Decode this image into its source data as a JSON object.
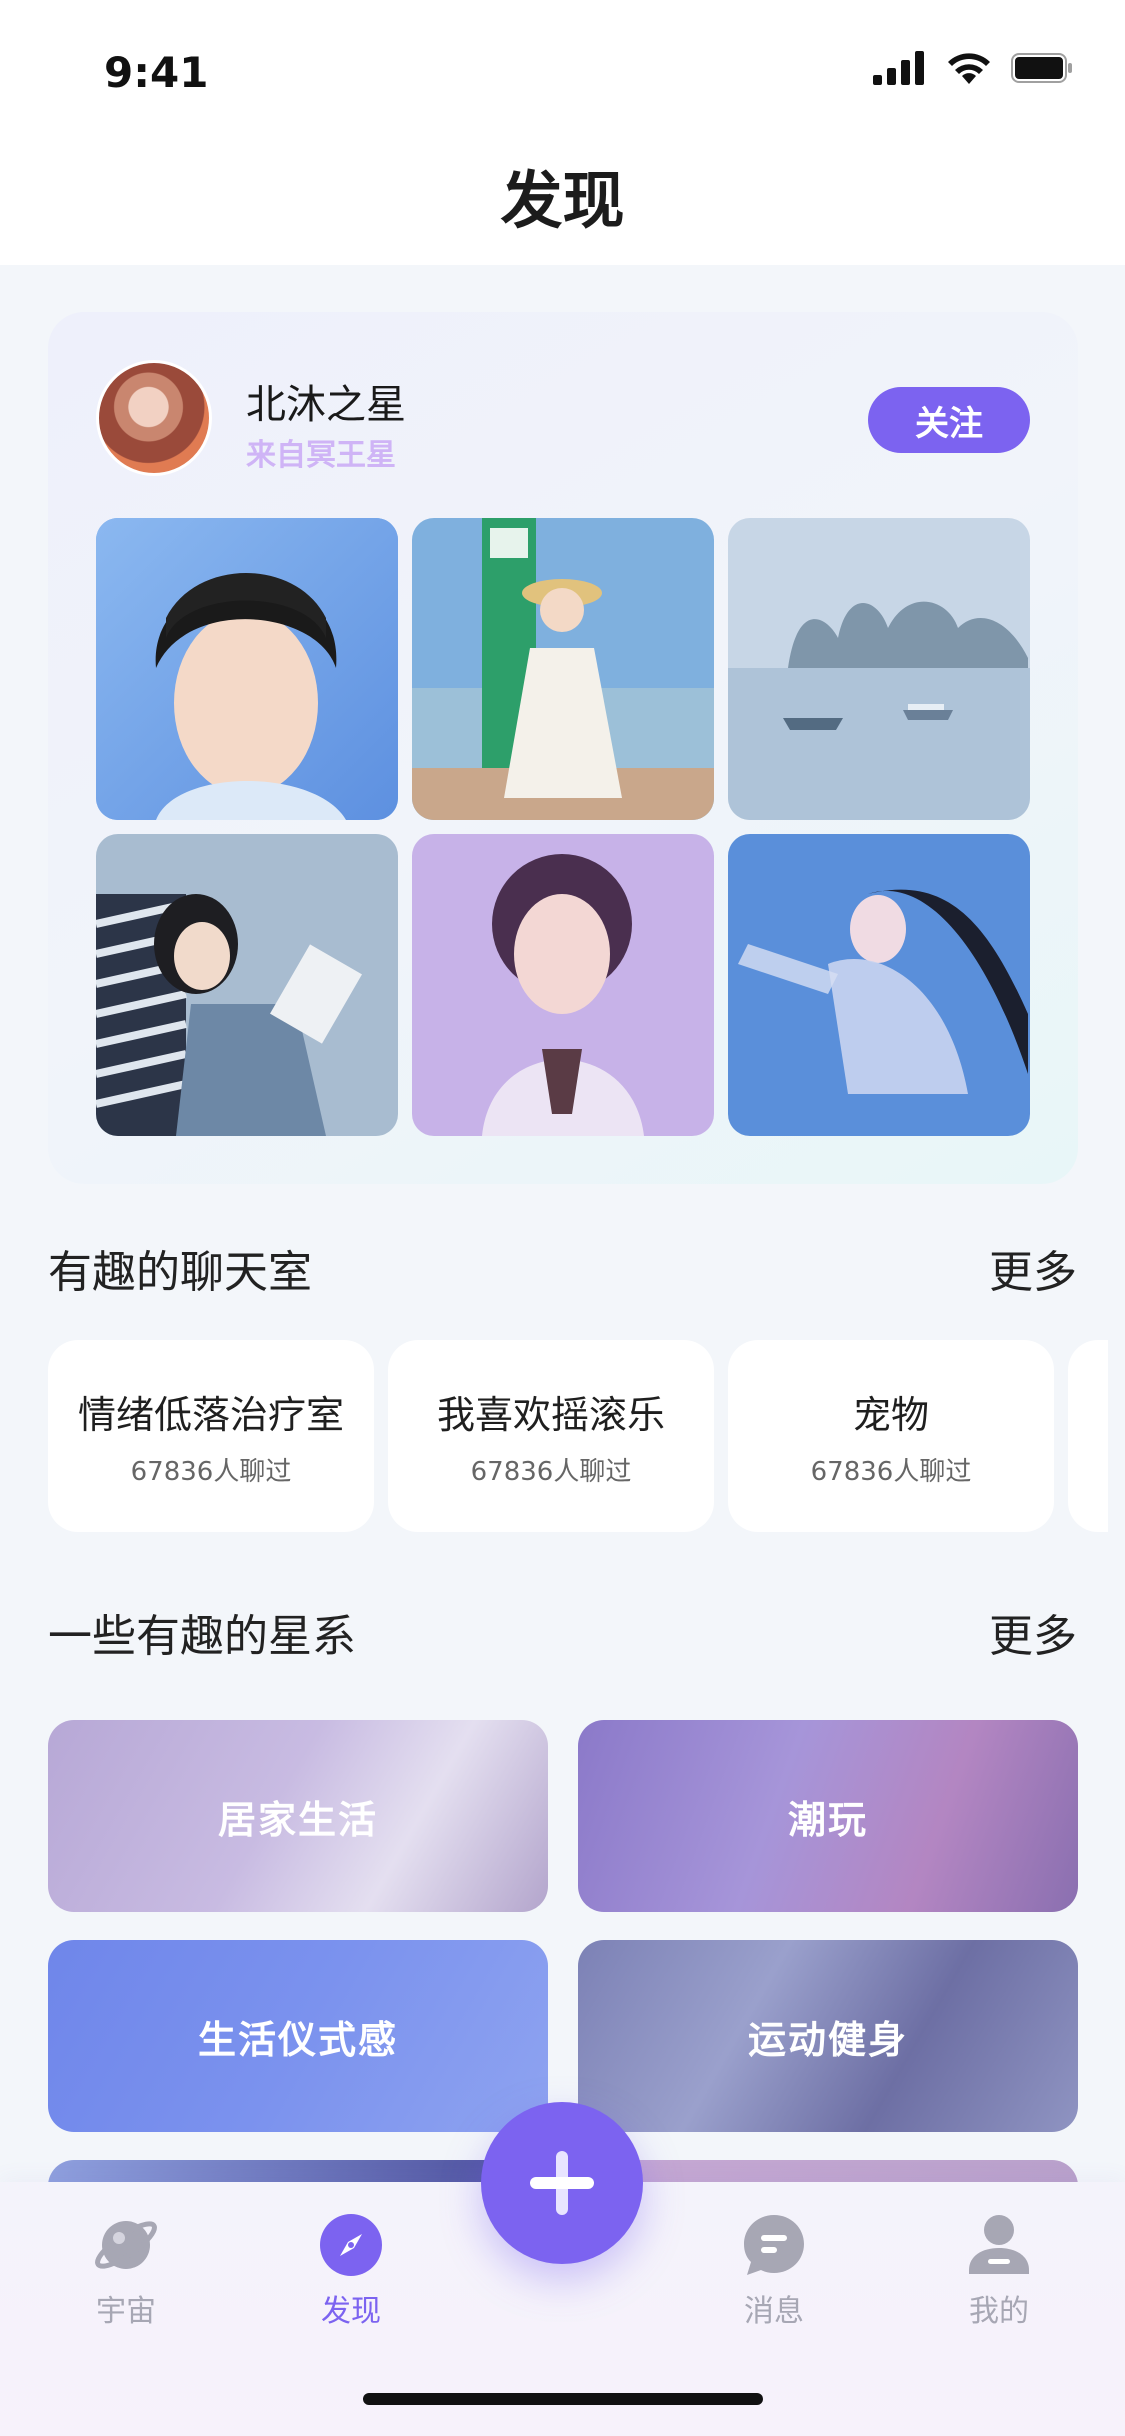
{
  "status_bar": {
    "time": "9:41"
  },
  "header": {
    "title": "发现"
  },
  "featured": {
    "author_name": "北沐之星",
    "author_from": "来自冥王星",
    "follow_label": "关注",
    "photos": [
      "portrait-boy-blue",
      "girl-straw-hat-lake",
      "misty-lake-boats",
      "girl-lying-reading",
      "girl-purple-haze",
      "girl-underwater-blue"
    ]
  },
  "chat_section": {
    "title": "有趣的聊天室",
    "more": "更多",
    "rooms": [
      {
        "name": "情绪低落治疗室",
        "count": "67836人聊过"
      },
      {
        "name": "我喜欢摇滚乐",
        "count": "67836人聊过"
      },
      {
        "name": "宠物",
        "count": "67836人聊过"
      }
    ]
  },
  "galaxy_section": {
    "title": "一些有趣的星系",
    "more": "更多",
    "items": [
      "居家生活",
      "潮玩",
      "生活仪式感",
      "运动健身"
    ]
  },
  "tabbar": {
    "items": [
      {
        "label": "宇宙",
        "icon": "planet-icon"
      },
      {
        "label": "发现",
        "icon": "compass-icon"
      },
      {
        "label": "消息",
        "icon": "message-icon"
      },
      {
        "label": "我的",
        "icon": "profile-icon"
      }
    ],
    "fab_icon": "plus-icon"
  },
  "colors": {
    "accent": "#7c63f0",
    "muted_tab": "#a7a7b4",
    "author_sub": "#cfb4f6"
  }
}
